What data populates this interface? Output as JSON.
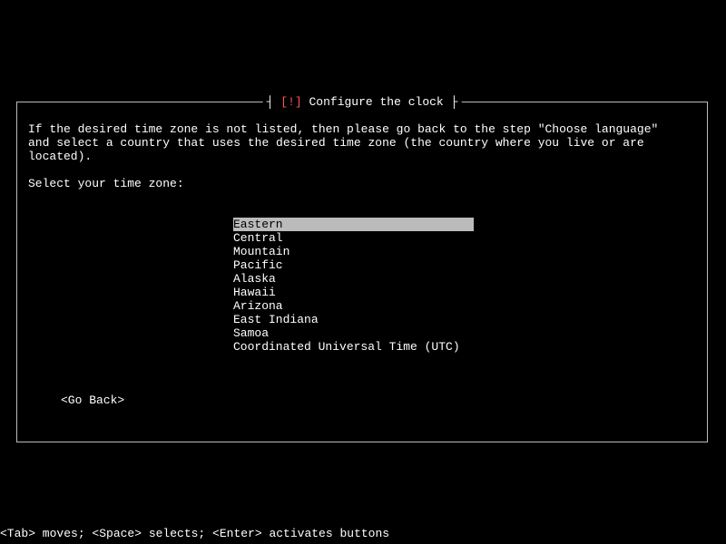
{
  "dialog": {
    "title_marker": "[!]",
    "title_text": "Configure the clock",
    "instruction": "If the desired time zone is not listed, then please go back to the step \"Choose language\"\nand select a country that uses the desired time zone (the country where you live or are\nlocated).",
    "prompt": "Select your time zone:",
    "options": [
      "Eastern",
      "Central",
      "Mountain",
      "Pacific",
      "Alaska",
      "Hawaii",
      "Arizona",
      "East Indiana",
      "Samoa",
      "Coordinated Universal Time (UTC)"
    ],
    "selected_index": 0,
    "go_back_label": "<Go Back>"
  },
  "footer": {
    "hint": "<Tab> moves; <Space> selects; <Enter> activates buttons"
  }
}
